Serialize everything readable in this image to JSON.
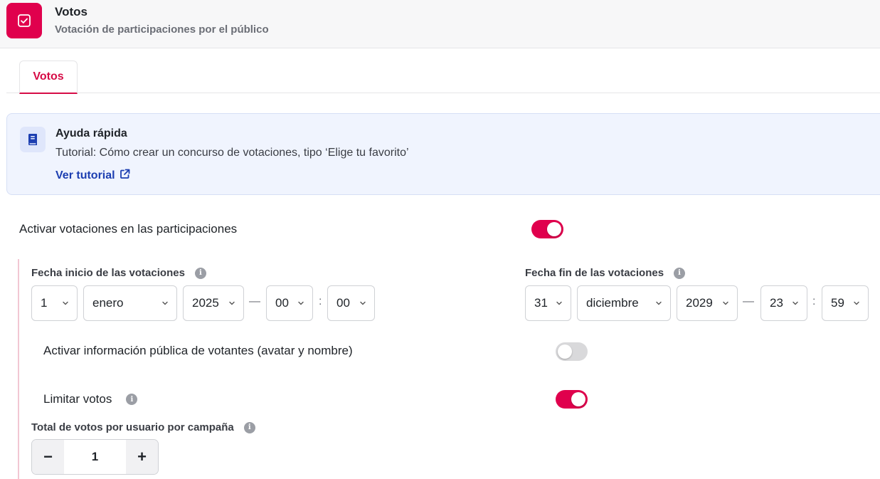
{
  "header": {
    "title": "Votos",
    "subtitle": "Votación de participaciones por el público",
    "icon": "checkbox-icon",
    "accent": "#e0004d"
  },
  "tabs": [
    {
      "label": "Votos",
      "active": true
    }
  ],
  "help": {
    "title": "Ayuda rápida",
    "text": "Tutorial: Cómo crear un concurso de votaciones, tipo ‘Elige tu favorito’",
    "link_label": "Ver tutorial",
    "icon": "book-icon",
    "link_icon": "external-link-icon"
  },
  "activate_voting": {
    "label": "Activar votaciones en las participaciones",
    "enabled": true
  },
  "start_date": {
    "label": "Fecha inicio de las votaciones",
    "day": "1",
    "month": "enero",
    "year": "2025",
    "hour": "00",
    "minute": "00"
  },
  "end_date": {
    "label": "Fecha fin de las votaciones",
    "day": "31",
    "month": "diciembre",
    "year": "2029",
    "hour": "23",
    "minute": "59"
  },
  "separators": {
    "date_time": "—",
    "time": ":"
  },
  "public_voters": {
    "label": "Activar información pública de votantes (avatar y nombre)",
    "enabled": false
  },
  "limit_votes": {
    "label": "Limitar votos",
    "enabled": true
  },
  "votes_per_user": {
    "label": "Total de votos por usuario por campaña",
    "value": "1",
    "minus": "−",
    "plus": "+"
  },
  "colors": {
    "primary": "#e0004d",
    "link": "#1d3fb1",
    "help_bg": "#f0f4fe"
  }
}
